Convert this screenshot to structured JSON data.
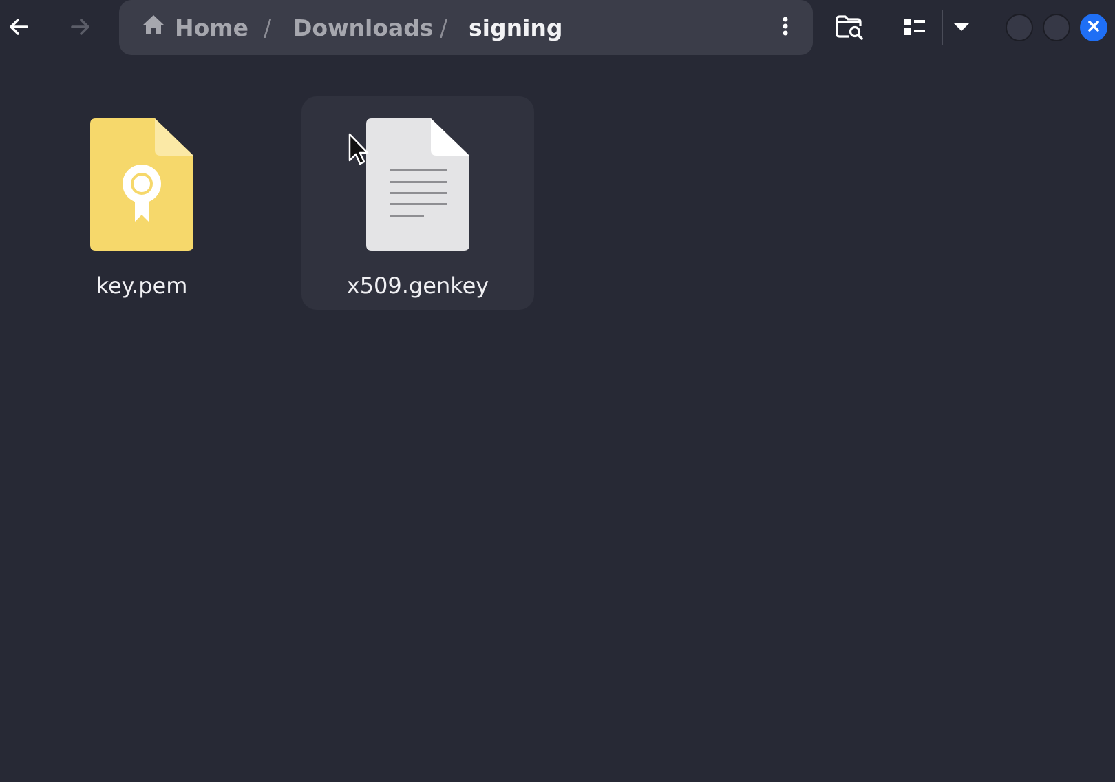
{
  "header": {
    "nav": {
      "back_icon": "arrow-left-icon",
      "forward_icon": "arrow-right-icon"
    },
    "breadcrumb": [
      {
        "label": "Home",
        "icon": "home-icon"
      },
      {
        "label": "Downloads"
      },
      {
        "label": "signing",
        "current": true
      }
    ],
    "separator": "/",
    "menu_icon": "vertical-ellipsis-icon",
    "tools": {
      "search_icon": "folder-search-icon",
      "view_icon": "list-view-icon",
      "view_dropdown_icon": "chevron-down-icon"
    },
    "window_controls": {
      "close_color": "#1f6ff5"
    }
  },
  "files": [
    {
      "name": "key.pem",
      "icon": "certificate-file-icon",
      "color": "#f6d86b",
      "selected": false
    },
    {
      "name": "x509.genkey",
      "icon": "text-file-icon",
      "color": "#e4e4e6",
      "selected": true
    }
  ],
  "colors": {
    "background": "#272935",
    "pathbar": "#3b3d49",
    "accent": "#1f6ff5"
  }
}
